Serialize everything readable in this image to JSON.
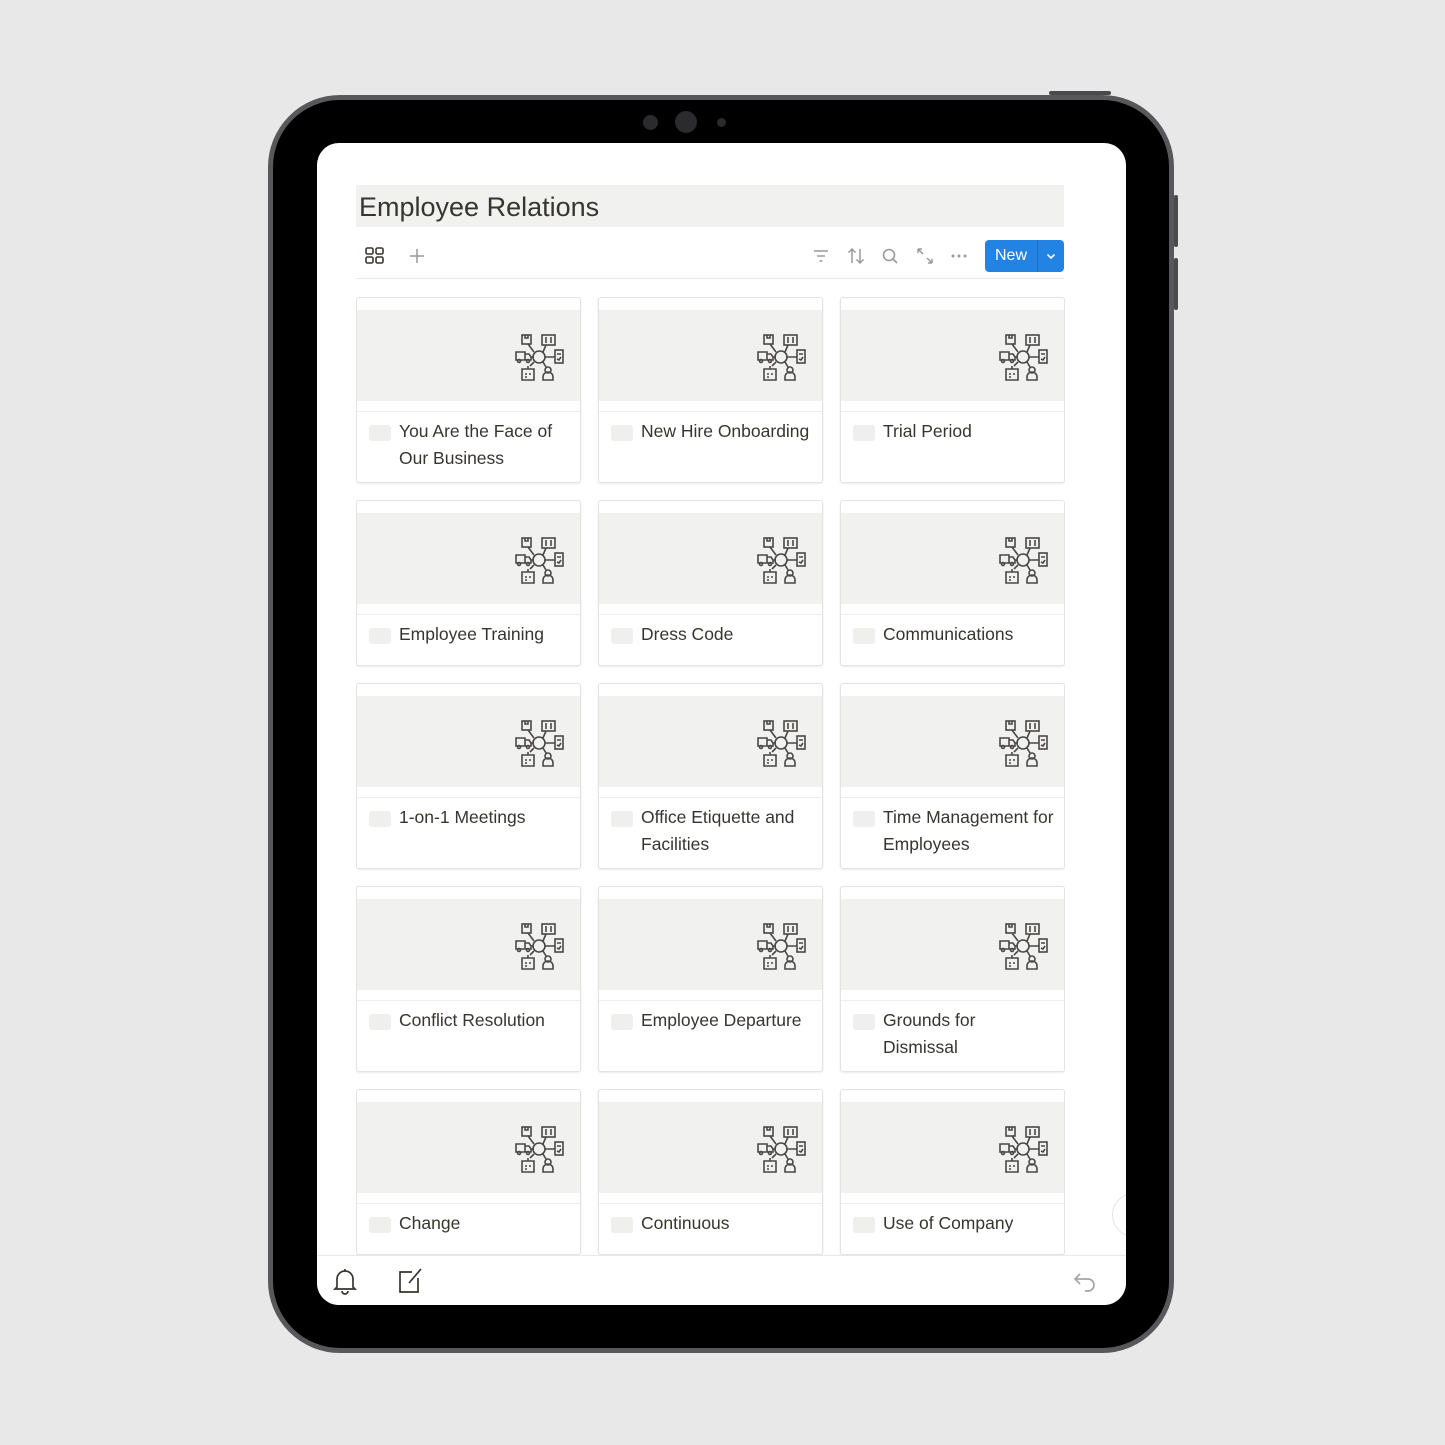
{
  "page": {
    "title": "Employee Relations"
  },
  "toolbar": {
    "view_icon": "gallery-grid-icon",
    "add_view_icon": "plus-icon",
    "filter_icon": "filter-icon",
    "sort_icon": "sort-icon",
    "search_icon": "search-icon",
    "expand_icon": "expand-icon",
    "more_icon": "more-icon",
    "new_label": "New",
    "new_dropdown_icon": "chevron-down-icon"
  },
  "colors": {
    "accent": "#2383e2",
    "cover": "#f1f1ef",
    "text": "#37352f"
  },
  "cards": [
    {
      "title": "You Are the Face of Our Business"
    },
    {
      "title": "New Hire Onboarding"
    },
    {
      "title": "Trial Period"
    },
    {
      "title": "Employee Training"
    },
    {
      "title": "Dress Code"
    },
    {
      "title": "Communications"
    },
    {
      "title": "1-on-1 Meetings"
    },
    {
      "title": "Office Etiquette and Facilities"
    },
    {
      "title": "Time Management for Employees"
    },
    {
      "title": "Conflict Resolution"
    },
    {
      "title": "Employee Departure"
    },
    {
      "title": "Grounds for Dismissal"
    },
    {
      "title": "Change"
    },
    {
      "title": "Continuous"
    },
    {
      "title": "Use of Company"
    }
  ],
  "bottom_bar": {
    "left_icons": [
      "bell-icon",
      "compose-icon"
    ],
    "right_icon": "undo-icon"
  }
}
